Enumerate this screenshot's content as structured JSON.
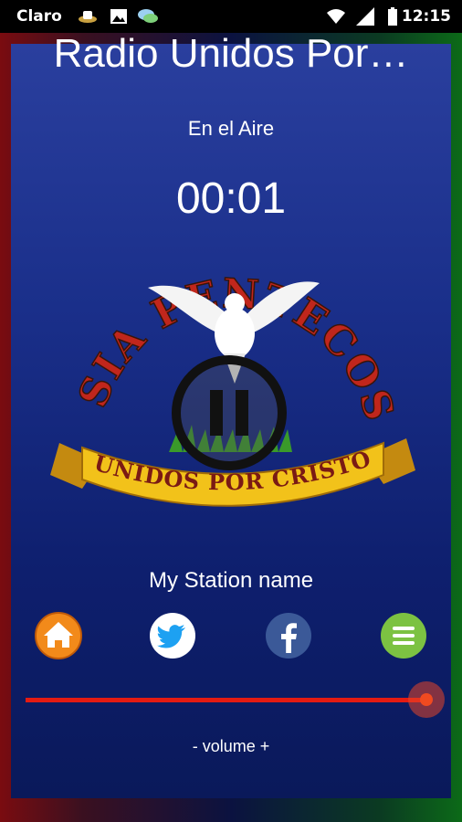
{
  "status_bar": {
    "carrier": "Claro",
    "time": "12:15",
    "icons": [
      "notification-icon",
      "image-icon",
      "chat-icon",
      "wifi-icon",
      "signal-icon",
      "battery-icon"
    ]
  },
  "player": {
    "title": "Radio Unidos Por…",
    "status": "En el Aire",
    "elapsed": "00:01",
    "station_name": "My Station name",
    "volume_label": "- volume +",
    "volume_level": 0.99
  },
  "logo": {
    "arc_text": "IGLESIA PENTECOSTES",
    "banner_text": "UNIDOS POR CRISTO"
  },
  "controls": [
    "home-icon",
    "twitter-icon",
    "facebook-icon",
    "menu-icon"
  ],
  "colors": {
    "panel": "#1a2f8a",
    "slider": "#e41b12",
    "home": "#f28a1a",
    "twitter": "#1da1f2",
    "facebook": "#3b5998",
    "menu": "#7cc242"
  }
}
